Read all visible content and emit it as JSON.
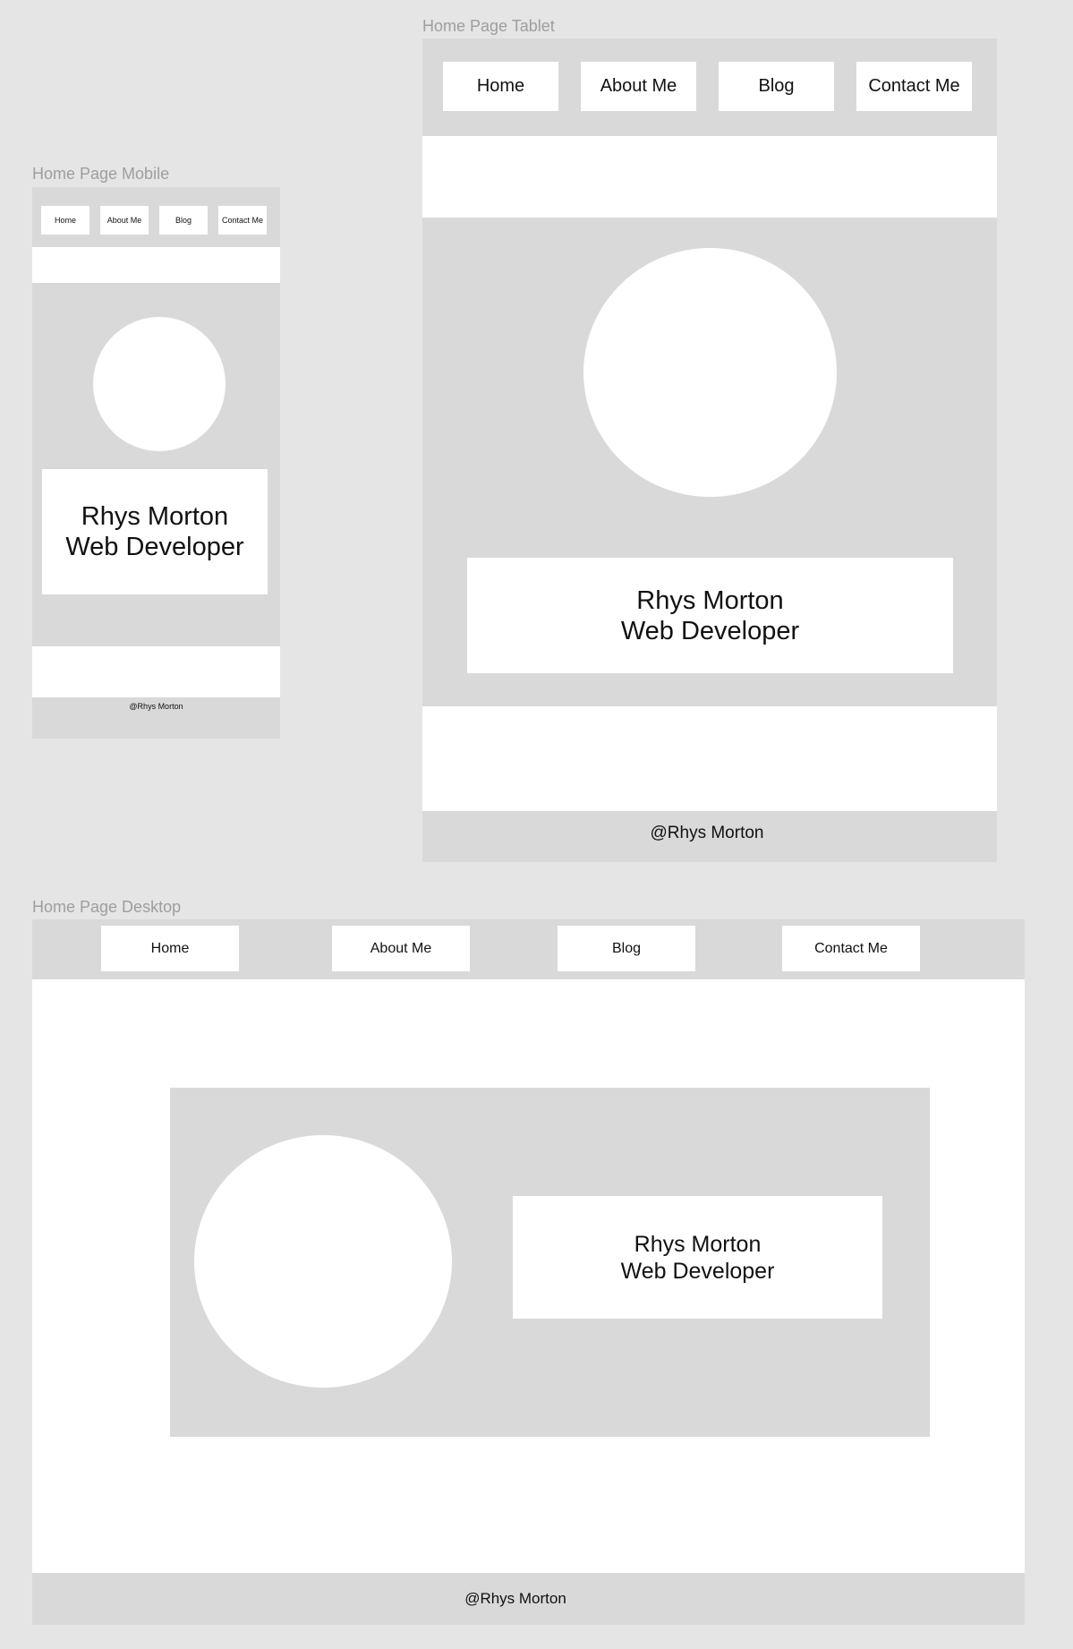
{
  "frames": {
    "mobile": {
      "label": "Home Page Mobile",
      "nav": [
        "Home",
        "About Me",
        "Blog",
        "Contact Me"
      ],
      "name": "Rhys Morton",
      "role": "Web Developer",
      "footer": "@Rhys Morton"
    },
    "tablet": {
      "label": "Home Page Tablet",
      "nav": [
        "Home",
        "About Me",
        "Blog",
        "Contact Me"
      ],
      "name": "Rhys Morton",
      "role": "Web Developer",
      "footer": "@Rhys Morton"
    },
    "desktop": {
      "label": "Home Page Desktop",
      "nav": [
        "Home",
        "About Me",
        "Blog",
        "Contact Me"
      ],
      "name": "Rhys Morton",
      "role": "Web Developer",
      "footer": "@Rhys Morton"
    }
  },
  "colors": {
    "canvas": "#e5e5e5",
    "frame": "#d9d9d9",
    "block": "#ffffff",
    "label": "#9e9e9e"
  }
}
